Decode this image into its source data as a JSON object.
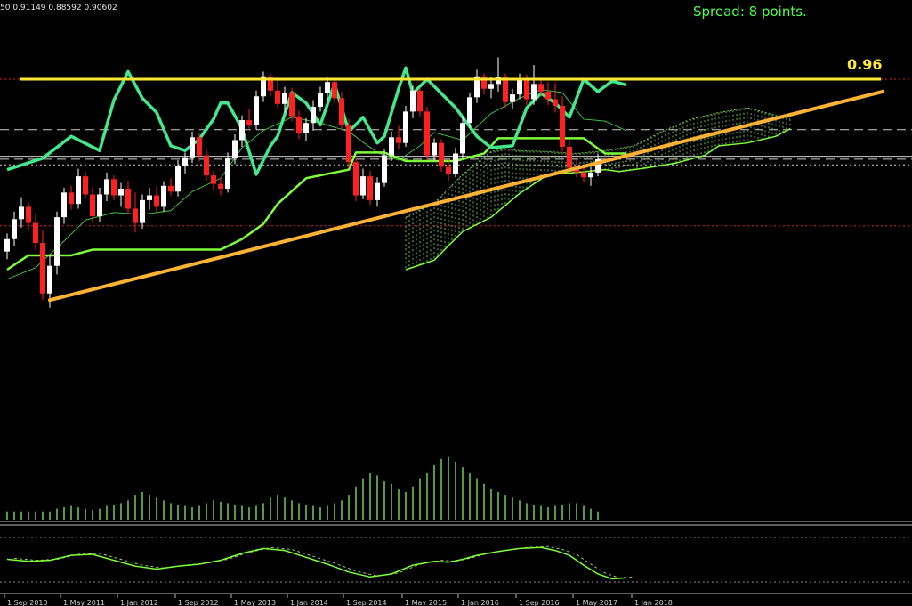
{
  "header": {
    "ohlc": "50 0.91149 0.88592 0.90602",
    "spread": "Spread: 8 points.",
    "level_label": "0.96"
  },
  "colors": {
    "bull_candle": "#ffffff",
    "bear_candle": "#ff2020",
    "kijun": "#7dff3a",
    "stoch_main": "#43e88a",
    "level": "#ffe633",
    "trendline": "#ffb233",
    "cloud": "#6fbf4a",
    "osc": "#7dff3a"
  },
  "chart_data": {
    "type": "candlestick",
    "title": "",
    "x_ticks": [
      "1 Sep 2010",
      "1 May 2011",
      "1 Jan 2012",
      "1 Sep 2012",
      "1 May 2013",
      "1 Jan 2014",
      "1 Sep 2014",
      "1 May 2015",
      "1 Jan 2016",
      "1 Sep 2016",
      "1 May 2017",
      "1 Jan 2018"
    ],
    "y_range": [
      0.7,
      1.0
    ],
    "annotations": {
      "resistance_level": 0.96,
      "trendline": [
        [
          0,
          0.728
        ],
        [
          97,
          0.947
        ]
      ]
    },
    "candles": [
      [
        0.779,
        0.798,
        0.771,
        0.792
      ],
      [
        0.792,
        0.821,
        0.785,
        0.813
      ],
      [
        0.813,
        0.836,
        0.804,
        0.826
      ],
      [
        0.826,
        0.831,
        0.802,
        0.809
      ],
      [
        0.809,
        0.818,
        0.781,
        0.788
      ],
      [
        0.788,
        0.801,
        0.728,
        0.735
      ],
      [
        0.735,
        0.776,
        0.72,
        0.764
      ],
      [
        0.764,
        0.821,
        0.755,
        0.815
      ],
      [
        0.815,
        0.846,
        0.808,
        0.841
      ],
      [
        0.841,
        0.848,
        0.823,
        0.829
      ],
      [
        0.829,
        0.866,
        0.824,
        0.858
      ],
      [
        0.858,
        0.863,
        0.834,
        0.839
      ],
      [
        0.839,
        0.846,
        0.81,
        0.816
      ],
      [
        0.816,
        0.846,
        0.81,
        0.839
      ],
      [
        0.839,
        0.862,
        0.832,
        0.855
      ],
      [
        0.855,
        0.859,
        0.833,
        0.838
      ],
      [
        0.838,
        0.851,
        0.826,
        0.845
      ],
      [
        0.845,
        0.853,
        0.818,
        0.824
      ],
      [
        0.824,
        0.841,
        0.799,
        0.809
      ],
      [
        0.809,
        0.839,
        0.803,
        0.833
      ],
      [
        0.833,
        0.846,
        0.823,
        0.838
      ],
      [
        0.838,
        0.847,
        0.819,
        0.826
      ],
      [
        0.826,
        0.853,
        0.821,
        0.848
      ],
      [
        0.848,
        0.856,
        0.838,
        0.842
      ],
      [
        0.842,
        0.875,
        0.837,
        0.869
      ],
      [
        0.869,
        0.883,
        0.861,
        0.878
      ],
      [
        0.878,
        0.905,
        0.872,
        0.899
      ],
      [
        0.899,
        0.903,
        0.874,
        0.88
      ],
      [
        0.88,
        0.886,
        0.853,
        0.859
      ],
      [
        0.859,
        0.864,
        0.843,
        0.85
      ],
      [
        0.85,
        0.857,
        0.838,
        0.845
      ],
      [
        0.845,
        0.883,
        0.841,
        0.877
      ],
      [
        0.877,
        0.902,
        0.871,
        0.896
      ],
      [
        0.896,
        0.922,
        0.889,
        0.917
      ],
      [
        0.917,
        0.929,
        0.908,
        0.912
      ],
      [
        0.912,
        0.948,
        0.907,
        0.942
      ],
      [
        0.942,
        0.968,
        0.936,
        0.963
      ],
      [
        0.963,
        0.966,
        0.942,
        0.948
      ],
      [
        0.948,
        0.962,
        0.93,
        0.934
      ],
      [
        0.934,
        0.952,
        0.925,
        0.946
      ],
      [
        0.946,
        0.951,
        0.916,
        0.921
      ],
      [
        0.921,
        0.927,
        0.897,
        0.903
      ],
      [
        0.903,
        0.919,
        0.895,
        0.914
      ],
      [
        0.914,
        0.938,
        0.906,
        0.931
      ],
      [
        0.931,
        0.952,
        0.926,
        0.945
      ],
      [
        0.945,
        0.962,
        0.938,
        0.957
      ],
      [
        0.957,
        0.961,
        0.936,
        0.94
      ],
      [
        0.94,
        0.947,
        0.907,
        0.912
      ],
      [
        0.912,
        0.918,
        0.867,
        0.873
      ],
      [
        0.873,
        0.877,
        0.832,
        0.838
      ],
      [
        0.838,
        0.866,
        0.834,
        0.858
      ],
      [
        0.858,
        0.864,
        0.828,
        0.833
      ],
      [
        0.833,
        0.857,
        0.826,
        0.851
      ],
      [
        0.851,
        0.886,
        0.847,
        0.88
      ],
      [
        0.88,
        0.905,
        0.874,
        0.899
      ],
      [
        0.899,
        0.911,
        0.887,
        0.893
      ],
      [
        0.893,
        0.932,
        0.889,
        0.926
      ],
      [
        0.926,
        0.953,
        0.919,
        0.948
      ],
      [
        0.948,
        0.951,
        0.921,
        0.926
      ],
      [
        0.926,
        0.931,
        0.875,
        0.88
      ],
      [
        0.88,
        0.898,
        0.874,
        0.893
      ],
      [
        0.893,
        0.897,
        0.863,
        0.868
      ],
      [
        0.868,
        0.876,
        0.853,
        0.86
      ],
      [
        0.86,
        0.888,
        0.857,
        0.882
      ],
      [
        0.882,
        0.92,
        0.877,
        0.914
      ],
      [
        0.914,
        0.946,
        0.909,
        0.941
      ],
      [
        0.941,
        0.97,
        0.935,
        0.963
      ],
      [
        0.963,
        0.966,
        0.944,
        0.95
      ],
      [
        0.95,
        0.962,
        0.94,
        0.955
      ],
      [
        0.955,
        0.983,
        0.947,
        0.962
      ],
      [
        0.962,
        0.966,
        0.93,
        0.936
      ],
      [
        0.936,
        0.95,
        0.929,
        0.944
      ],
      [
        0.944,
        0.966,
        0.939,
        0.96
      ],
      [
        0.96,
        0.965,
        0.933,
        0.939
      ],
      [
        0.939,
        0.975,
        0.933,
        0.955
      ],
      [
        0.955,
        0.962,
        0.942,
        0.947
      ],
      [
        0.947,
        0.957,
        0.933,
        0.939
      ],
      [
        0.939,
        0.956,
        0.925,
        0.932
      ],
      [
        0.932,
        0.942,
        0.884,
        0.889
      ],
      [
        0.889,
        0.897,
        0.862,
        0.867
      ],
      [
        0.867,
        0.876,
        0.857,
        0.862
      ],
      [
        0.862,
        0.869,
        0.852,
        0.857
      ],
      [
        0.857,
        0.868,
        0.848,
        0.862
      ],
      [
        0.862,
        0.882,
        0.858,
        0.876
      ]
    ],
    "kijun": [
      [
        0,
        0.76
      ],
      [
        3,
        0.775
      ],
      [
        9,
        0.775
      ],
      [
        12,
        0.781
      ],
      [
        30,
        0.781
      ],
      [
        33,
        0.792
      ],
      [
        36,
        0.808
      ],
      [
        38,
        0.829
      ],
      [
        42,
        0.856
      ],
      [
        48,
        0.865
      ],
      [
        49,
        0.883
      ],
      [
        53,
        0.883
      ],
      [
        56,
        0.874
      ],
      [
        63,
        0.874
      ],
      [
        67,
        0.882
      ],
      [
        69,
        0.898
      ],
      [
        81,
        0.898
      ],
      [
        84,
        0.882
      ],
      [
        87,
        0.882
      ]
    ],
    "tenkan": [
      [
        0,
        0.75
      ],
      [
        4,
        0.762
      ],
      [
        8,
        0.79
      ],
      [
        11,
        0.812
      ],
      [
        15,
        0.82
      ],
      [
        19,
        0.818
      ],
      [
        23,
        0.822
      ],
      [
        26,
        0.842
      ],
      [
        30,
        0.856
      ],
      [
        33,
        0.888
      ],
      [
        36,
        0.906
      ],
      [
        40,
        0.92
      ],
      [
        44,
        0.914
      ],
      [
        48,
        0.905
      ],
      [
        52,
        0.883
      ],
      [
        55,
        0.875
      ],
      [
        58,
        0.89
      ],
      [
        60,
        0.904
      ],
      [
        64,
        0.896
      ],
      [
        68,
        0.924
      ],
      [
        72,
        0.94
      ],
      [
        75,
        0.949
      ],
      [
        78,
        0.946
      ],
      [
        81,
        0.918
      ],
      [
        84,
        0.916
      ],
      [
        87,
        0.906
      ]
    ],
    "stoch_line": [
      [
        0,
        0.865
      ],
      [
        5,
        0.877
      ],
      [
        9,
        0.9
      ],
      [
        13,
        0.885
      ],
      [
        15,
        0.938
      ],
      [
        17,
        0.968
      ],
      [
        19,
        0.94
      ],
      [
        21,
        0.925
      ],
      [
        23,
        0.89
      ],
      [
        25,
        0.885
      ],
      [
        27,
        0.897
      ],
      [
        29,
        0.918
      ],
      [
        30,
        0.935
      ],
      [
        31,
        0.935
      ],
      [
        33,
        0.908
      ],
      [
        35,
        0.86
      ],
      [
        37,
        0.89
      ],
      [
        38,
        0.9
      ],
      [
        40,
        0.946
      ],
      [
        42,
        0.935
      ],
      [
        44,
        0.912
      ],
      [
        46,
        0.955
      ],
      [
        48,
        0.905
      ],
      [
        50,
        0.92
      ],
      [
        52,
        0.893
      ],
      [
        53,
        0.9
      ],
      [
        55,
        0.95
      ],
      [
        56,
        0.972
      ],
      [
        57,
        0.945
      ],
      [
        59,
        0.96
      ],
      [
        61,
        0.945
      ],
      [
        63,
        0.93
      ],
      [
        66,
        0.9
      ],
      [
        68,
        0.888
      ],
      [
        71,
        0.89
      ],
      [
        73,
        0.93
      ],
      [
        75,
        0.945
      ],
      [
        77,
        0.935
      ],
      [
        79,
        0.92
      ],
      [
        81,
        0.96
      ],
      [
        83,
        0.947
      ],
      [
        85,
        0.958
      ],
      [
        87,
        0.954
      ]
    ],
    "cloud": {
      "upper": [
        [
          56,
          0.815
        ],
        [
          60,
          0.83
        ],
        [
          64,
          0.86
        ],
        [
          68,
          0.884
        ],
        [
          70,
          0.887
        ],
        [
          72,
          0.885
        ],
        [
          76,
          0.884
        ],
        [
          80,
          0.882
        ],
        [
          84,
          0.885
        ],
        [
          88,
          0.89
        ],
        [
          92,
          0.905
        ],
        [
          96,
          0.918
        ],
        [
          100,
          0.925
        ],
        [
          104,
          0.93
        ],
        [
          108,
          0.922
        ],
        [
          110,
          0.918
        ]
      ],
      "lower": [
        [
          56,
          0.76
        ],
        [
          60,
          0.77
        ],
        [
          64,
          0.8
        ],
        [
          68,
          0.815
        ],
        [
          72,
          0.84
        ],
        [
          76,
          0.86
        ],
        [
          80,
          0.862
        ],
        [
          84,
          0.865
        ],
        [
          86,
          0.863
        ],
        [
          90,
          0.867
        ],
        [
          94,
          0.872
        ],
        [
          98,
          0.88
        ],
        [
          100,
          0.89
        ],
        [
          104,
          0.893
        ],
        [
          108,
          0.9
        ],
        [
          110,
          0.908
        ]
      ]
    },
    "volume": [
      6,
      6,
      6,
      6,
      6,
      6,
      6,
      8,
      9,
      10,
      9,
      8,
      7,
      8,
      10,
      11,
      12,
      14,
      18,
      20,
      18,
      16,
      14,
      12,
      11,
      10,
      9,
      10,
      12,
      14,
      13,
      12,
      11,
      10,
      9,
      10,
      12,
      16,
      18,
      16,
      14,
      12,
      11,
      10,
      9,
      10,
      12,
      14,
      18,
      24,
      30,
      34,
      32,
      28,
      26,
      22,
      20,
      24,
      30,
      34,
      40,
      44,
      46,
      42,
      38,
      34,
      30,
      26,
      22,
      20,
      18,
      16,
      14,
      12,
      11,
      10,
      9,
      10,
      11,
      12,
      12,
      10,
      8,
      6
    ],
    "oscillator": [
      [
        0,
        50
      ],
      [
        3,
        46
      ],
      [
        6,
        48
      ],
      [
        9,
        58
      ],
      [
        12,
        60
      ],
      [
        15,
        48
      ],
      [
        18,
        36
      ],
      [
        21,
        30
      ],
      [
        24,
        36
      ],
      [
        27,
        40
      ],
      [
        30,
        48
      ],
      [
        33,
        62
      ],
      [
        36,
        72
      ],
      [
        39,
        68
      ],
      [
        42,
        54
      ],
      [
        45,
        40
      ],
      [
        48,
        24
      ],
      [
        51,
        14
      ],
      [
        54,
        20
      ],
      [
        57,
        38
      ],
      [
        60,
        46
      ],
      [
        62,
        44
      ],
      [
        64,
        50
      ],
      [
        66,
        58
      ],
      [
        69,
        66
      ],
      [
        72,
        72
      ],
      [
        75,
        74
      ],
      [
        77,
        68
      ],
      [
        79,
        58
      ],
      [
        81,
        38
      ],
      [
        83,
        20
      ],
      [
        85,
        10
      ],
      [
        87,
        12
      ]
    ]
  }
}
